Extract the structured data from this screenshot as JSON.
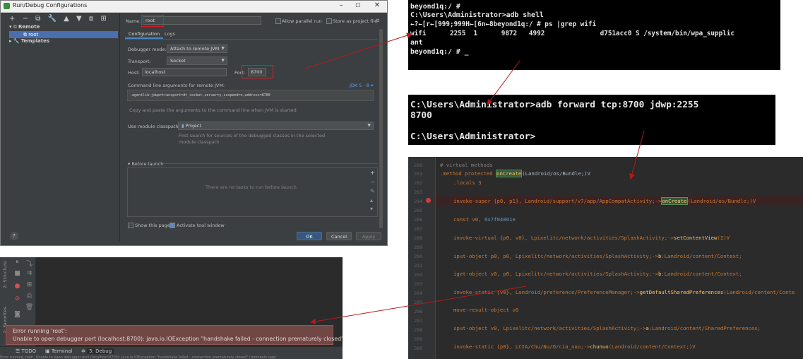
{
  "dialog": {
    "title": "Run/Debug Configurations",
    "tree": {
      "toolbar": [
        "+",
        "−",
        "⧉",
        "🔧",
        "▲",
        "▼",
        "⧈",
        "⊞"
      ],
      "remote_label": "Remote",
      "root_label": "root",
      "templates_label": "Templates"
    },
    "name_label": "Name:",
    "name_value": "root",
    "allow_parallel_label": "Allow parallel run",
    "store_project_label": "Store as project file",
    "tabs": [
      "Configuration",
      "Logs"
    ],
    "debugger_mode_label": "Debugger mode:",
    "debugger_mode_value": "Attach to remote JVM",
    "transport_label": "Transport:",
    "transport_value": "Socket",
    "host_label": "Host:",
    "host_value": "localhost",
    "port_label": "Port:",
    "port_value": "8700",
    "cmd_label": "Command line arguments for remote JVM:",
    "jdk_label": "JDK 5 - 8 ▾",
    "cmd_value": "-agentlib:jdwp=transport=dt_socket,server=y,suspend=n,address=8700",
    "cmd_hint": "Copy and paste the arguments to the command line when JVM is started",
    "classpath_label": "Use module classpath:",
    "classpath_value": "Project",
    "classpath_hint1": "First search for sources of the debugged classes in the selected",
    "classpath_hint2": "module classpath",
    "before_launch_label": "▾  Before launch",
    "before_launch_empty": "There are no tasks to run before launch",
    "show_page_label": "Show this page",
    "activate_tool_label": "Activate tool window",
    "ok_label": "OK",
    "cancel_label": "Cancel",
    "apply_label": "Apply",
    "help_label": "?"
  },
  "shell1": {
    "lines": [
      "beyond1q:/ #",
      "C:\\Users\\Administrator>adb shell",
      "←?←[r←[999;999H←[6n←8beyond1q:/ # ps |grep wifi",
      "wifi      2255  1      9872   4992              d751acc0 S /system/bin/wpa_supplic",
      "ant",
      "beyond1q:/ # _"
    ]
  },
  "shell2": {
    "lines": [
      "C:\\Users\\Administrator>adb forward tcp:8700 jdwp:2255",
      "8700",
      "",
      "C:\\Users\\Administrator>"
    ]
  },
  "editor": {
    "line_numbers": [
      "280",
      "281",
      "282",
      "283",
      "284",
      "285",
      "286",
      "287",
      "288",
      "289",
      "290",
      "291",
      "292",
      "293",
      "294",
      "295",
      "296",
      "297",
      "298",
      "299",
      "300"
    ],
    "comment": "# virtual methods",
    "method_kw": ".method protected",
    "method_name": "onCreate",
    "method_sig": "(Landroid/os/Bundle;)V",
    "locals": ".locals 3",
    "invoke_super_a": "invoke-super {p0, p1}, Landroid/support/v7/app/AppCompatActivity;->",
    "invoke_super_fn": "onCreate",
    "invoke_super_b": "(Landroid/os/Bundle;)V",
    "const_a": "const v0, ",
    "const_num": "0x7f04001e",
    "invoke_virtual_a": "invoke-virtual {p0, v0}, Lpixelitc/network/activities/SplashActivity;->",
    "invoke_virtual_fn": "setContentView",
    "invoke_virtual_b": "(I)V",
    "iput_a": "iput-object p0, p0, Lpixelitc/network/activities/SplashActivity;->",
    "iput_fn": "b",
    "iput_b": ":Landroid/content/Context;",
    "iget_a": "iget-object v0, p0, Lpixelitc/network/activities/SplashActivity;->",
    "iget_fn": "b",
    "iget_b": ":Landroid/content/Context;",
    "invoke_static_a": "invoke-static {v0}, Landroid/preference/PreferenceManager;->",
    "invoke_static_fn": "getDefaultSharedPreferences",
    "invoke_static_b": "(Landroid/content/Conte",
    "move_result": "move-result-object v0",
    "sput_a": "sput-object v0, Lpixelitc/network/activities/SplashActivity;->",
    "sput_fn": "a",
    "sput_b": ":Landroid/content/SharedPreferences;",
    "invoke_static2_a": "invoke-static {p0}, LCIA/Chu/Nu/O/cia_nuo;->",
    "invoke_static2_fn": "chunuo",
    "invoke_static2_b": "(Landroid/content/Context;)V"
  },
  "ide": {
    "structure_label": "2: Structure",
    "favorites_label": "2: Favorites",
    "error_line1": "Error running 'root':",
    "error_line2": "Unable to open debugger port (localhost:8700): java.io.IOException \"handshake failed - connection prematurely closed\"",
    "tabs": [
      "☰ TODO",
      "▣ Terminal",
      "5: Debug"
    ],
    "status_text": "Error running 'root': Unable to open debugger port (localhost:8700): java.io.IOException \"handshake failed - connection prematurely closed\" (moments ago)"
  },
  "colors": {
    "arrow": "#b31b1b",
    "ide_bg": "#3c3f41",
    "error_bg": "#704745"
  }
}
